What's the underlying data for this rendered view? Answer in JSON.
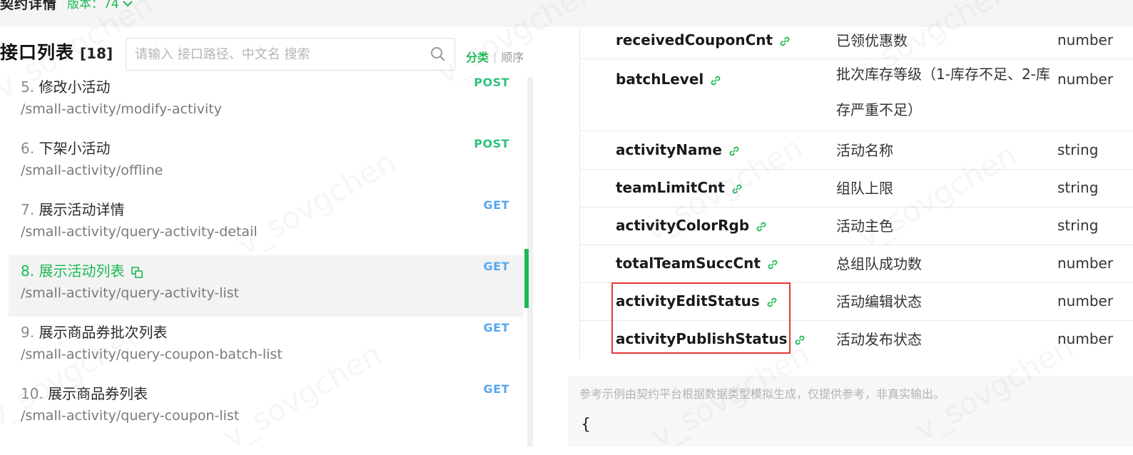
{
  "header": {
    "title": "契约详情",
    "version_label": "版本：74"
  },
  "api_list": {
    "title": "接口列表",
    "count": "[18]",
    "search_placeholder": "请输入 接口路径、中文名 搜索",
    "sort": {
      "active": "分类",
      "separator": "|",
      "inactive": "顺序"
    },
    "items": [
      {
        "number": "5.",
        "name": "修改小活动",
        "path": "/small-activity/modify-activity",
        "method": "POST"
      },
      {
        "number": "6.",
        "name": "下架小活动",
        "path": "/small-activity/offline",
        "method": "POST"
      },
      {
        "number": "7.",
        "name": "展示活动详情",
        "path": "/small-activity/query-activity-detail",
        "method": "GET"
      },
      {
        "number": "8.",
        "name": "展示活动列表",
        "path": "/small-activity/query-activity-list",
        "method": "GET",
        "selected": true
      },
      {
        "number": "9.",
        "name": "展示商品券批次列表",
        "path": "/small-activity/query-coupon-batch-list",
        "method": "GET"
      },
      {
        "number": "10.",
        "name": "展示商品券列表",
        "path": "/small-activity/query-coupon-list",
        "method": "GET"
      }
    ]
  },
  "fields": [
    {
      "name": "receivedCouponCnt",
      "desc": "已领优惠数",
      "type": "number"
    },
    {
      "name": "batchLevel",
      "desc": "批次库存等级（1-库存不足、2-库存严重不足）",
      "type": "number"
    },
    {
      "name": "activityName",
      "desc": "活动名称",
      "type": "string"
    },
    {
      "name": "teamLimitCnt",
      "desc": "组队上限",
      "type": "string"
    },
    {
      "name": "activityColorRgb",
      "desc": "活动主色",
      "type": "string"
    },
    {
      "name": "totalTeamSuccCnt",
      "desc": "总组队成功数",
      "type": "number"
    },
    {
      "name": "activityEditStatus",
      "desc": "活动编辑状态",
      "type": "number"
    },
    {
      "name": "activityPublishStatus",
      "desc": "活动发布状态",
      "type": "number"
    }
  ],
  "example": {
    "note": "参考示例由契约平台根据数据类型模拟生成，仅提供参考，非真实输出。",
    "json_open": "{"
  },
  "watermark": "v_sovgchen",
  "colors": {
    "accent": "#1db954",
    "get": "#56a8f0",
    "post": "#2ec27e",
    "highlight": "#e53935"
  }
}
